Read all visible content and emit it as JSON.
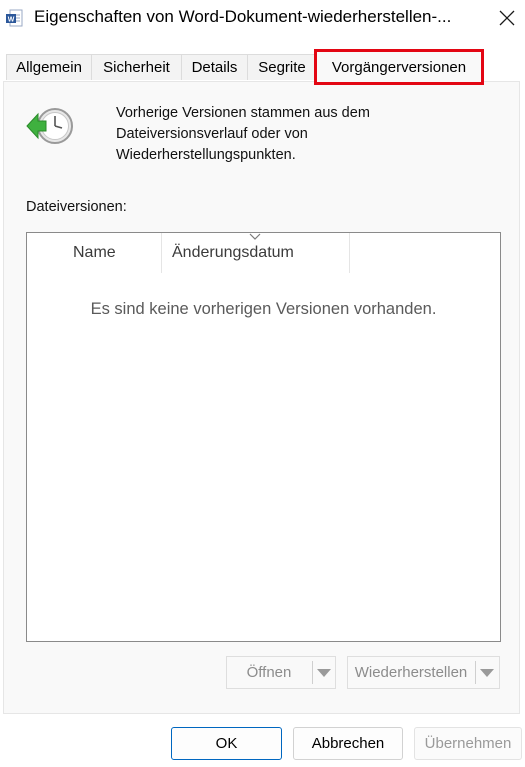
{
  "window": {
    "title": "Eigenschaften von Word-Dokument-wiederherstellen-...",
    "app_icon": "word-document-icon",
    "close_icon": "close-icon"
  },
  "tabs": [
    {
      "label": "Allgemein",
      "active": false
    },
    {
      "label": "Sicherheit",
      "active": false
    },
    {
      "label": "Details",
      "active": false
    },
    {
      "label": "Segrite",
      "active": false
    },
    {
      "label": "Vorgängerversionen",
      "active": true
    }
  ],
  "colors": {
    "highlight": "#e30613",
    "accent": "#0067c0"
  },
  "info": {
    "icon": "history-clock-icon",
    "description": "Vorherige Versionen stammen aus dem Dateiversionsverlauf oder von Wiederherstellungspunkten."
  },
  "versions": {
    "label": "Dateiversionen:",
    "columns": [
      "Name",
      "Änderungsdatum"
    ],
    "empty_message": "Es sind keine vorherigen Versionen vorhanden."
  },
  "actions": {
    "open_label": "Öffnen",
    "restore_label": "Wiederherstellen"
  },
  "footer": {
    "ok_label": "OK",
    "cancel_label": "Abbrechen",
    "apply_label": "Übernehmen"
  }
}
